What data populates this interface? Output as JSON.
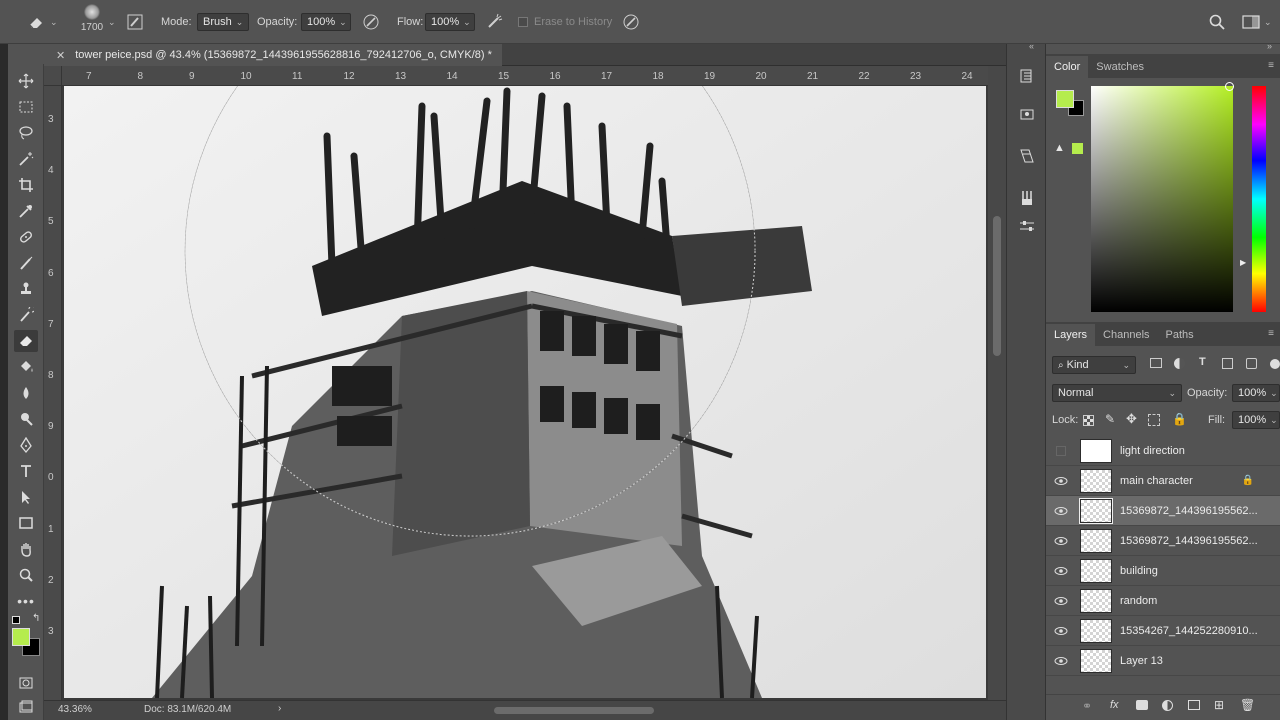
{
  "options": {
    "brush_size": "1700",
    "mode_label": "Mode:",
    "mode_value": "Brush",
    "opacity_label": "Opacity:",
    "opacity_value": "100%",
    "flow_label": "Flow:",
    "flow_value": "100%",
    "erase_to_history_label": "Erase to History"
  },
  "document": {
    "tab_title": "tower peice.psd @ 43.4% (15369872_1443961955628816_792412706_o, CMYK/8) *",
    "ruler_top": [
      "7",
      "8",
      "9",
      "10",
      "11",
      "12",
      "13",
      "14",
      "15",
      "16",
      "17",
      "18",
      "19",
      "20",
      "21",
      "22",
      "23",
      "24"
    ],
    "ruler_left": [
      "3",
      "4",
      "5",
      "6",
      "7",
      "8",
      "9",
      "0",
      "1",
      "2",
      "3"
    ],
    "zoom": "43.36%",
    "doc_size": "Doc: 83.1M/620.4M"
  },
  "color_panel": {
    "tabs": [
      "Color",
      "Swatches"
    ],
    "foreground": "#b5ec4d",
    "background": "#000000"
  },
  "layers_panel": {
    "tabs": [
      "Layers",
      "Channels",
      "Paths"
    ],
    "filter_kind": "Kind",
    "blend_mode": "Normal",
    "opacity_label": "Opacity:",
    "opacity_value": "100%",
    "lock_label": "Lock:",
    "fill_label": "Fill:",
    "fill_value": "100%",
    "layers": [
      {
        "name": "light direction",
        "visible": false,
        "locked": false,
        "selected": false
      },
      {
        "name": "main character",
        "visible": true,
        "locked": true,
        "selected": false
      },
      {
        "name": "15369872_144396195562...",
        "visible": true,
        "locked": false,
        "selected": true
      },
      {
        "name": "15369872_144396195562...",
        "visible": true,
        "locked": false,
        "selected": false
      },
      {
        "name": "building",
        "visible": true,
        "locked": false,
        "selected": false
      },
      {
        "name": "random",
        "visible": true,
        "locked": false,
        "selected": false
      },
      {
        "name": "15354267_144252280910...",
        "visible": true,
        "locked": false,
        "selected": false
      },
      {
        "name": "Layer 13",
        "visible": true,
        "locked": false,
        "selected": false
      }
    ]
  }
}
